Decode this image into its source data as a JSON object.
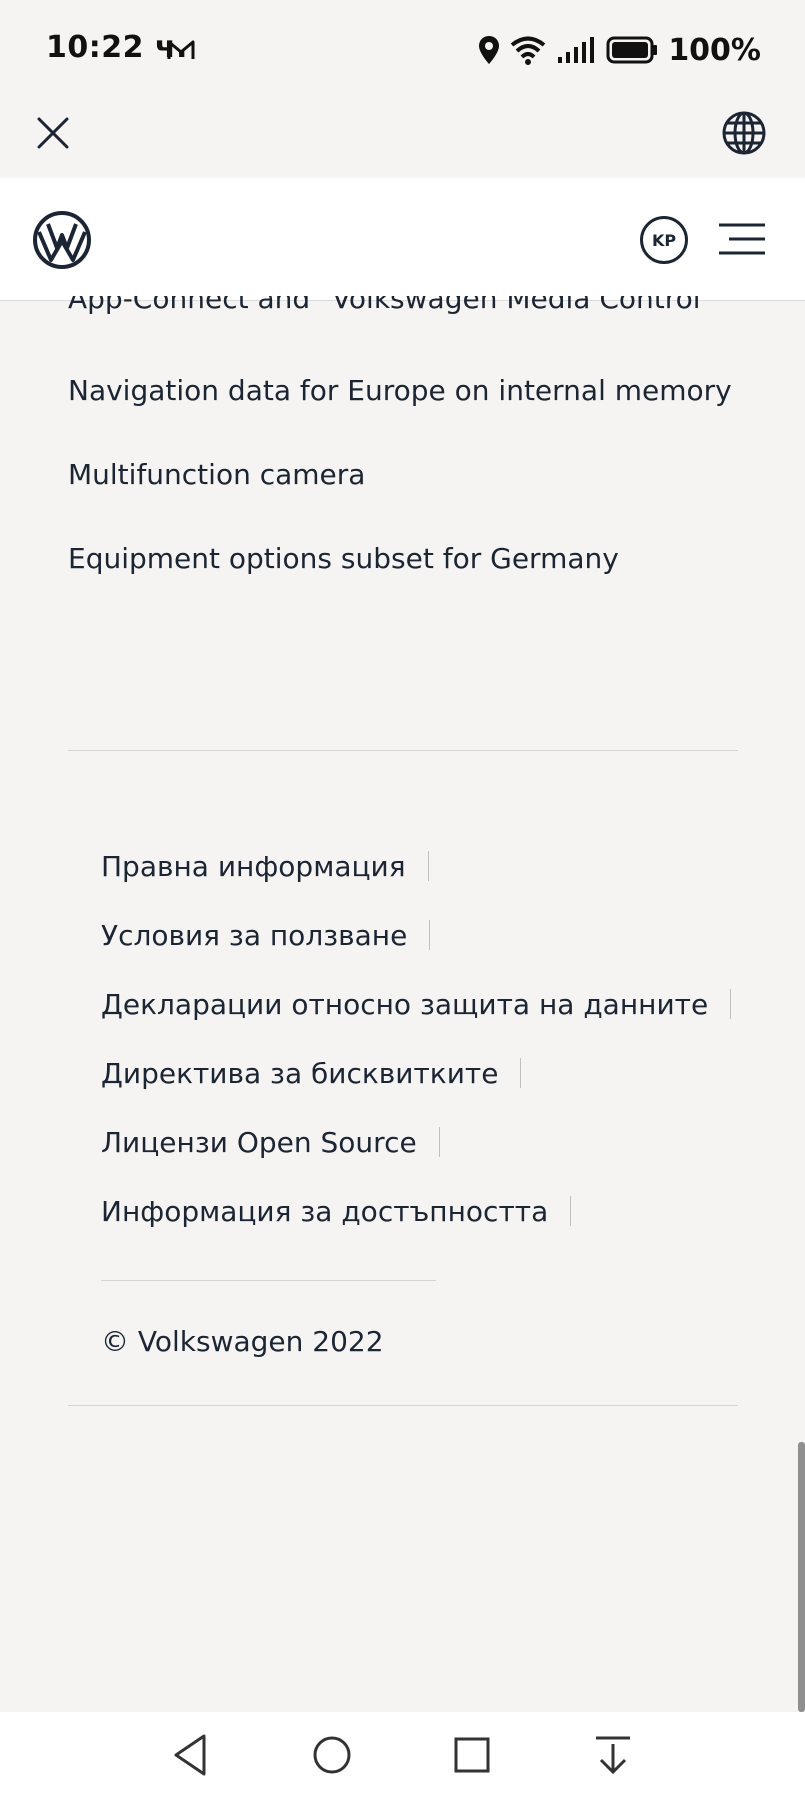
{
  "status_bar": {
    "time": "10:22 ч.",
    "battery": "100%"
  },
  "header": {
    "account_initials": "KP"
  },
  "content_items": [
    "App-Connect and \"Volkswagen Media Control\"",
    "Navigation data for Europe on internal memory",
    "Multifunction camera",
    "Equipment options subset for Germany"
  ],
  "footer": {
    "links": [
      "Правна информация",
      "Условия за ползване",
      "Декларации относно защита на данните",
      "Директива за бисквитките",
      "Лицензи Open Source",
      "Информация за достъпността"
    ],
    "copyright": "© Volkswagen 2022"
  },
  "icons": {
    "status": [
      "mail-icon",
      "location-icon",
      "wifi-icon",
      "signal-icon",
      "battery-icon"
    ],
    "top_bar": [
      "close-icon",
      "globe-icon"
    ],
    "header": [
      "vw-logo",
      "menu-icon"
    ],
    "nav": [
      "back-icon",
      "home-icon",
      "recents-icon",
      "notification-pull-icon"
    ]
  },
  "colors": {
    "background": "#f5f4f2",
    "header_background": "#ffffff",
    "text": "#1c2533",
    "divider": "#d4d4d4"
  }
}
